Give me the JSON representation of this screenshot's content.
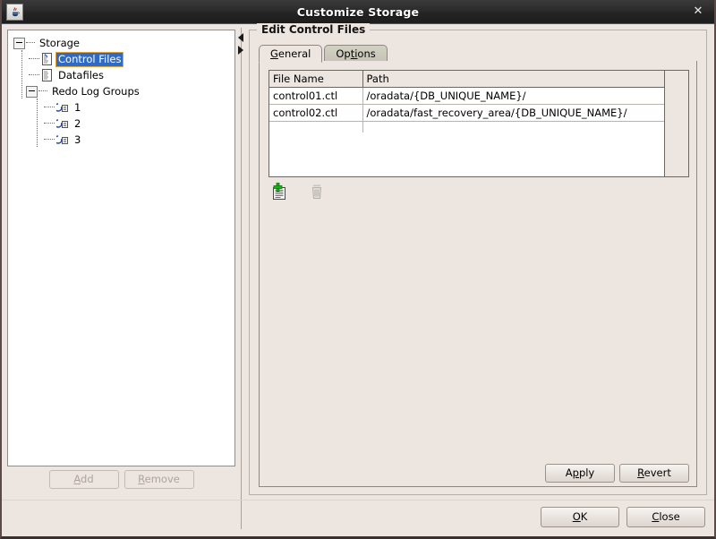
{
  "window": {
    "title": "Customize Storage",
    "icon": "java-coffee-cup-icon",
    "close_label": "✕"
  },
  "tree": {
    "root_label": "Storage",
    "items": [
      {
        "label": "Control Files",
        "icon": "control-file-icon",
        "selected": true
      },
      {
        "label": "Datafiles",
        "icon": "datafile-icon",
        "selected": false
      },
      {
        "label": "Redo Log Groups",
        "icon": "folder-icon",
        "selected": false
      },
      {
        "label": "1",
        "icon": "redo-log-icon",
        "selected": false
      },
      {
        "label": "2",
        "icon": "redo-log-icon",
        "selected": false
      },
      {
        "label": "3",
        "icon": "redo-log-icon",
        "selected": false
      }
    ],
    "buttons": {
      "add": {
        "label": "Add",
        "mnemonic": "A",
        "enabled": false
      },
      "remove": {
        "label": "Remove",
        "mnemonic": "R",
        "enabled": false
      }
    }
  },
  "splitter": {
    "collapse_left_icon": "triangle-left-icon",
    "collapse_right_icon": "triangle-right-icon"
  },
  "panel": {
    "title": "Edit Control Files",
    "tabs": [
      {
        "label": "General",
        "mnemonic": "G",
        "active": true
      },
      {
        "label": "Options",
        "mnemonic": "ti",
        "active": false
      }
    ],
    "table": {
      "columns": [
        "File Name",
        "Path"
      ],
      "rows": [
        {
          "file_name": "control01.ctl",
          "path": "/oradata/{DB_UNIQUE_NAME}/"
        },
        {
          "file_name": "control02.ctl",
          "path": "/oradata/fast_recovery_area/{DB_UNIQUE_NAME}/"
        },
        {
          "file_name": "",
          "path": ""
        }
      ]
    },
    "toolbar": {
      "add": {
        "icon": "add-file-icon",
        "enabled": true
      },
      "delete": {
        "icon": "trash-delete-icon",
        "enabled": false
      }
    },
    "apply_label": "Apply",
    "apply_mnemonic": "p",
    "revert_label": "Revert",
    "revert_mnemonic": "R"
  },
  "dialog_buttons": {
    "ok": {
      "label": "OK",
      "mnemonic": "O"
    },
    "close": {
      "label": "Close",
      "mnemonic": "C"
    }
  },
  "colors": {
    "titlebar_bg": "#2b2b2b",
    "panel_bg": "#ece5e0",
    "selection_bg": "#2f6bc4",
    "selection_border": "#e0a33a",
    "field_bg": "#ffffff",
    "border": "#8e8881"
  }
}
